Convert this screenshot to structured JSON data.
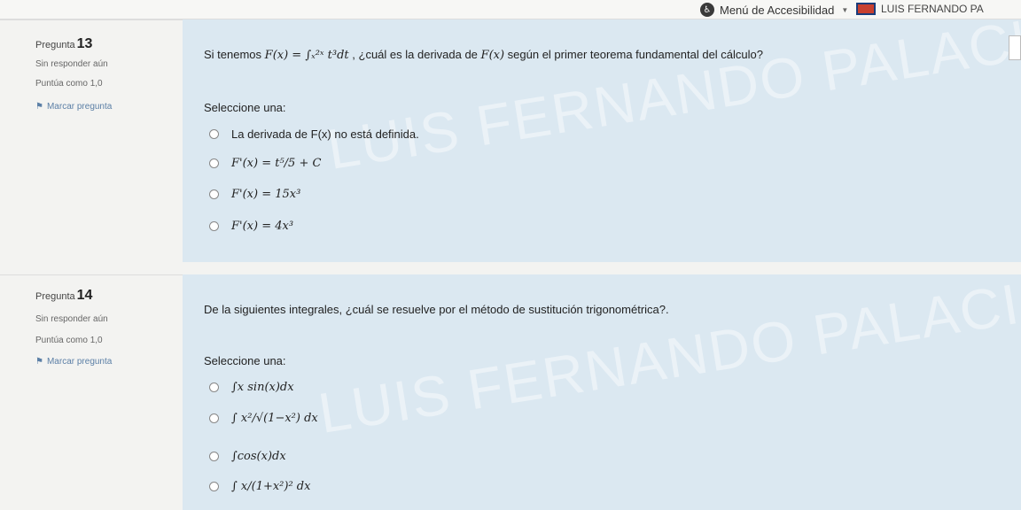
{
  "topbar": {
    "accessibility_label": "Menú de Accesibilidad",
    "user_name": "LUIS FERNANDO PA"
  },
  "q13": {
    "number_label": "Pregunta",
    "number": "13",
    "status": "Sin responder aún",
    "score": "Puntúa como 1,0",
    "flag": "Marcar pregunta",
    "text_before": "Si tenemos",
    "formula": "F(x) = ∫ₓ²ˣ t³dt",
    "text_after": ", ¿cuál es la derivada de",
    "formula2": "F(x)",
    "text_end": "según el primer teorema fundamental del cálculo?",
    "prompt": "Seleccione una:",
    "options": [
      "La derivada de F(x) no está definida.",
      "F'(x) = t⁵/5 + C",
      "F'(x) = 15x³",
      "F'(x) = 4x³"
    ],
    "watermark": "LUIS FERNANDO PALACIOS PALA"
  },
  "q14": {
    "number_label": "Pregunta",
    "number": "14",
    "status": "Sin responder aún",
    "score": "Puntúa como 1,0",
    "flag": "Marcar pregunta",
    "text": "De la siguientes integrales, ¿cuál se resuelve por el método de sustitución trigonométrica?.",
    "prompt": "Seleccione una:",
    "options": [
      "∫x sin(x)dx",
      "∫ x²/√(1−x²) dx",
      "∫cos(x)dx",
      "∫ x/(1+x²)² dx"
    ],
    "watermark": "LUIS FERNANDO PALACIOS PALA"
  }
}
